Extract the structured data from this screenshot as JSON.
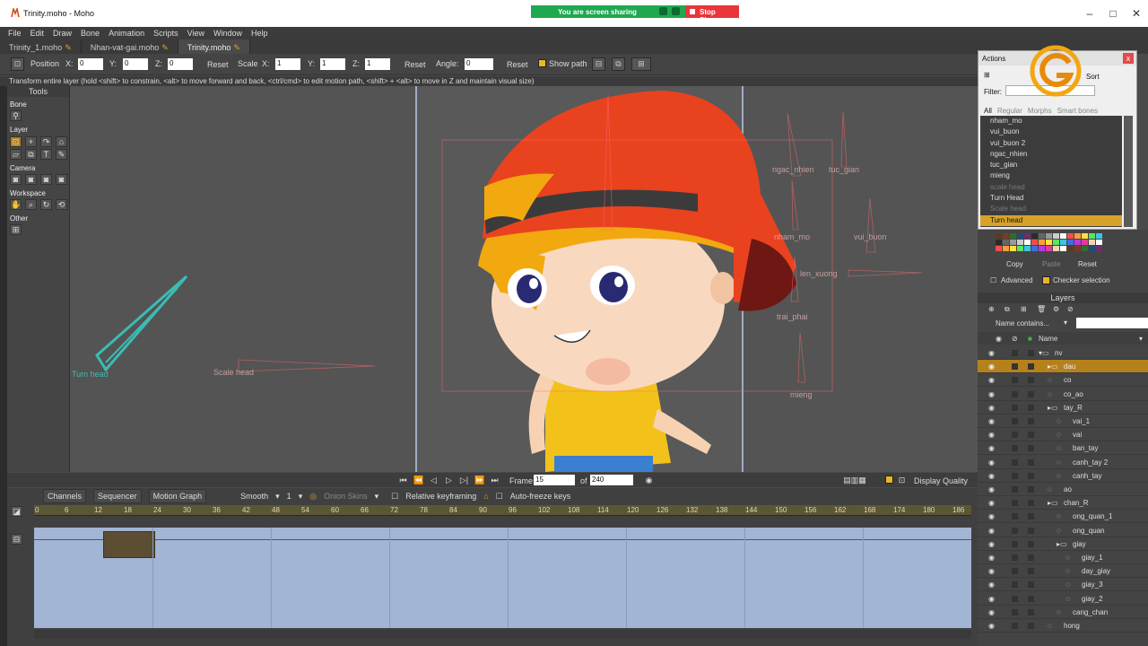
{
  "window": {
    "title": "Trinity.moho - Moho",
    "screen_share_text": "You are screen sharing",
    "stop_share_label": "Stop Share"
  },
  "menu": [
    "File",
    "Edit",
    "Draw",
    "Bone",
    "Animation",
    "Scripts",
    "View",
    "Window",
    "Help"
  ],
  "doc_tabs": [
    {
      "label": "Trinity_1.moho",
      "active": false
    },
    {
      "label": "Nhan-vat-gai.moho",
      "active": false
    },
    {
      "label": "Trinity.moho",
      "active": true
    }
  ],
  "tool_options": {
    "position_label": "Position",
    "x_label": "X:",
    "y_label": "Y:",
    "z_label": "Z:",
    "pos_x": "0",
    "pos_y": "0",
    "pos_z": "0",
    "reset_label": "Reset",
    "scale_label": "Scale",
    "scale_x": "1",
    "scale_y": "1",
    "scale_z": "1",
    "angle_label": "Angle:",
    "angle": "0",
    "show_path_label": "Show path"
  },
  "hint": "Transform entire layer (hold <shift> to constrain, <alt> to move forward and back, <ctrl/cmd> to edit motion path, <shift> + <alt> to move in Z and maintain visual size)",
  "tools": {
    "header": "Tools",
    "groups": [
      "Bone",
      "Layer",
      "Camera",
      "Workspace",
      "Other"
    ]
  },
  "canvas": {
    "bone_labels": [
      "Turn head",
      "Scale head",
      "ngac_nhien",
      "tuc_gian",
      "nham_mo",
      "vui_buon",
      "len_xuong",
      "trai_phai",
      "mieng"
    ]
  },
  "playback": {
    "frame_label": "Frame",
    "frame": "15",
    "of_label": "of",
    "total": "240",
    "display_quality_label": "Display Quality"
  },
  "timeline": {
    "tabs": [
      "Channels",
      "Sequencer",
      "Motion Graph"
    ],
    "interp": "Smooth",
    "interp_count": "1",
    "onion_label": "Onion Skins",
    "relative_label": "Relative keyframing",
    "autofreeze_label": "Auto-freeze keys",
    "ruler": [
      "0",
      "6",
      "12",
      "18",
      "24",
      "30",
      "36",
      "42",
      "48",
      "54",
      "60",
      "66",
      "72",
      "78",
      "84",
      "90",
      "96",
      "102",
      "108",
      "114",
      "120",
      "126",
      "132",
      "138",
      "144",
      "150",
      "156",
      "162",
      "168",
      "174",
      "180",
      "186"
    ]
  },
  "actions": {
    "title": "Actions",
    "sort_label": "Sort",
    "filter_label": "Filter:",
    "tabs": [
      "All",
      "Regular",
      "Morphs",
      "Smart bones"
    ],
    "items": [
      {
        "name": "nham_mo",
        "state": "normal"
      },
      {
        "name": "vui_buon",
        "state": "normal"
      },
      {
        "name": "vui_buon 2",
        "state": "normal"
      },
      {
        "name": "ngac_nhien",
        "state": "normal"
      },
      {
        "name": "tuc_gian",
        "state": "normal"
      },
      {
        "name": "mieng",
        "state": "normal"
      },
      {
        "name": "scale head",
        "state": "dim"
      },
      {
        "name": "Turn Head",
        "state": "normal"
      },
      {
        "name": "Scale head",
        "state": "dim"
      },
      {
        "name": "Turn head",
        "state": "selected"
      }
    ]
  },
  "style_panel": {
    "copy_label": "Copy",
    "paste_label": "Paste",
    "reset_label": "Reset",
    "advanced_label": "Advanced",
    "checker_label": "Checker selection"
  },
  "layers": {
    "header": "Layers",
    "filter_placeholder": "Name contains...",
    "name_col": "Name",
    "rows": [
      {
        "name": "nv",
        "indent": 0,
        "type": "bone-group",
        "selected": false
      },
      {
        "name": "dau",
        "indent": 1,
        "type": "group",
        "selected": true
      },
      {
        "name": "co",
        "indent": 1,
        "type": "vector",
        "selected": false
      },
      {
        "name": "co_ao",
        "indent": 1,
        "type": "vector",
        "selected": false
      },
      {
        "name": "tay_R",
        "indent": 1,
        "type": "group",
        "selected": false
      },
      {
        "name": "vai_1",
        "indent": 2,
        "type": "vector",
        "selected": false
      },
      {
        "name": "vai",
        "indent": 2,
        "type": "vector",
        "selected": false
      },
      {
        "name": "ban_tay",
        "indent": 2,
        "type": "vector",
        "selected": false
      },
      {
        "name": "canh_tay 2",
        "indent": 2,
        "type": "vector",
        "selected": false
      },
      {
        "name": "canh_tay",
        "indent": 2,
        "type": "vector",
        "selected": false
      },
      {
        "name": "ao",
        "indent": 1,
        "type": "vector",
        "selected": false
      },
      {
        "name": "chan_R",
        "indent": 1,
        "type": "group",
        "selected": false
      },
      {
        "name": "ong_quan_1",
        "indent": 2,
        "type": "vector",
        "selected": false
      },
      {
        "name": "ong_quan",
        "indent": 2,
        "type": "vector",
        "selected": false
      },
      {
        "name": "giay",
        "indent": 2,
        "type": "group",
        "selected": false
      },
      {
        "name": "giay_1",
        "indent": 3,
        "type": "vector",
        "selected": false
      },
      {
        "name": "day_giay",
        "indent": 3,
        "type": "vector",
        "selected": false
      },
      {
        "name": "giay_3",
        "indent": 3,
        "type": "vector",
        "selected": false
      },
      {
        "name": "giay_2",
        "indent": 3,
        "type": "vector",
        "selected": false
      },
      {
        "name": "cang_chan",
        "indent": 2,
        "type": "vector",
        "selected": false
      },
      {
        "name": "hong",
        "indent": 1,
        "type": "vector",
        "selected": false
      }
    ]
  },
  "colors": {
    "accent": "#d8a229",
    "canvas_bg": "#545454",
    "timeline_track": "#a3b5d4",
    "turn_head_bone": "#3bbcb4"
  }
}
